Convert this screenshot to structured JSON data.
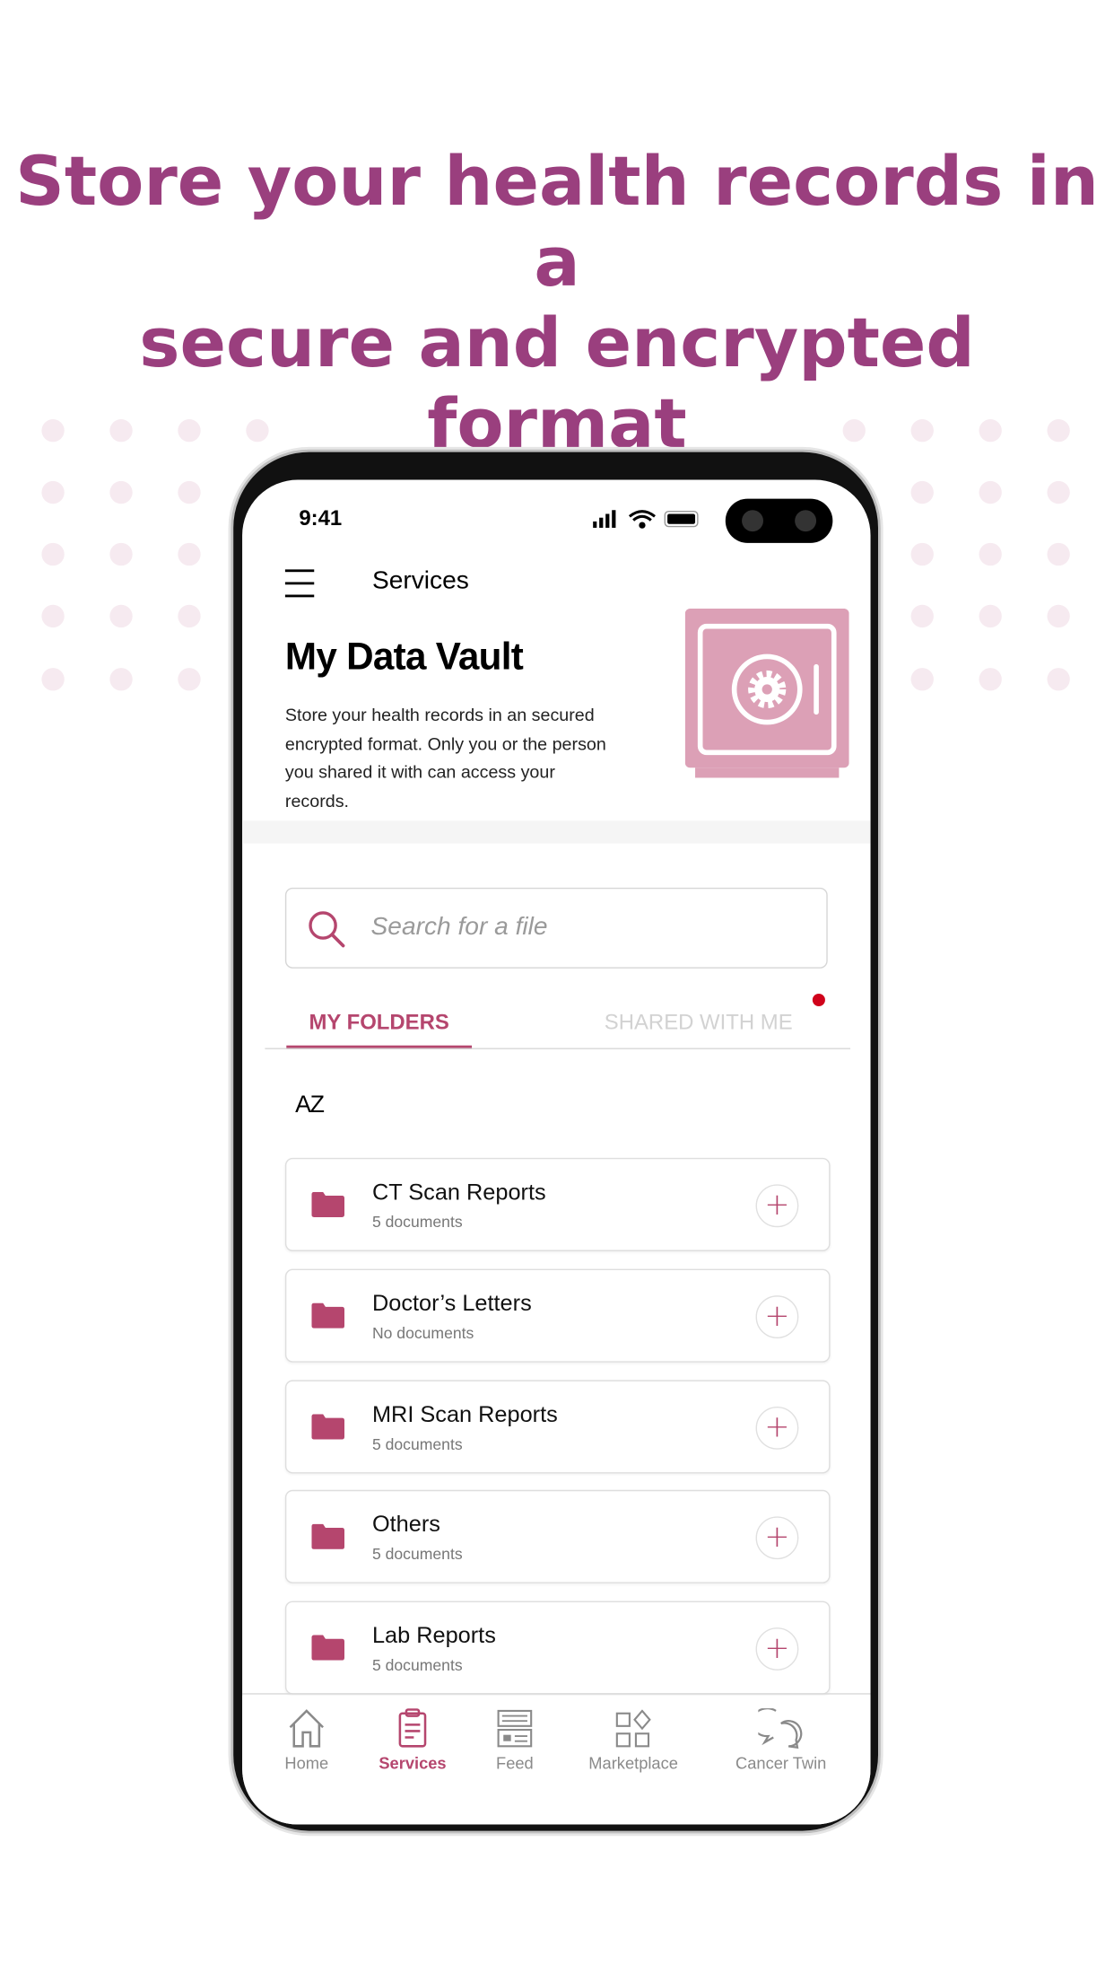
{
  "headline": {
    "line1": "Store your health records in a",
    "line2": "secure and encrypted format"
  },
  "colors": {
    "brand": "#9a3f7e",
    "accent": "#b5466e",
    "vault_pink": "#dca0b6",
    "notification": "#d0021b"
  },
  "status_bar": {
    "time": "9:41",
    "icons": [
      "signal-icon",
      "wifi-icon",
      "battery-icon"
    ]
  },
  "header": {
    "menu_icon": "hamburger-icon",
    "title": "Services"
  },
  "hero": {
    "title": "My Data Vault",
    "description_lines": [
      "Store your health records in an secured",
      "encrypted format. Only you or the person",
      "you shared it with can access your",
      "records."
    ],
    "image_icon": "safe-vault-icon"
  },
  "search": {
    "placeholder": "Search for a file",
    "icon": "search-icon"
  },
  "tabs": [
    {
      "label": "MY FOLDERS",
      "active": true
    },
    {
      "label": "SHARED WITH ME",
      "active": false,
      "has_notification": true
    }
  ],
  "sort": {
    "label": "AZ",
    "icon": "sort-az-icon"
  },
  "folders": [
    {
      "name": "CT Scan Reports",
      "count": "5 documents"
    },
    {
      "name": "Doctor’s Letters",
      "count": "No documents"
    },
    {
      "name": "MRI Scan Reports",
      "count": "5 documents"
    },
    {
      "name": "Others",
      "count": "5 documents"
    },
    {
      "name": "Lab Reports",
      "count": "5 documents"
    }
  ],
  "bottom_nav": [
    {
      "label": "Home",
      "icon": "home-icon",
      "active": false
    },
    {
      "label": "Services",
      "icon": "clipboard-icon",
      "active": true
    },
    {
      "label": "Feed",
      "icon": "feed-icon",
      "active": false
    },
    {
      "label": "Marketplace",
      "icon": "marketplace-icon",
      "active": false
    },
    {
      "label": "Cancer Twin",
      "icon": "chat-bubbles-icon",
      "active": false
    }
  ]
}
